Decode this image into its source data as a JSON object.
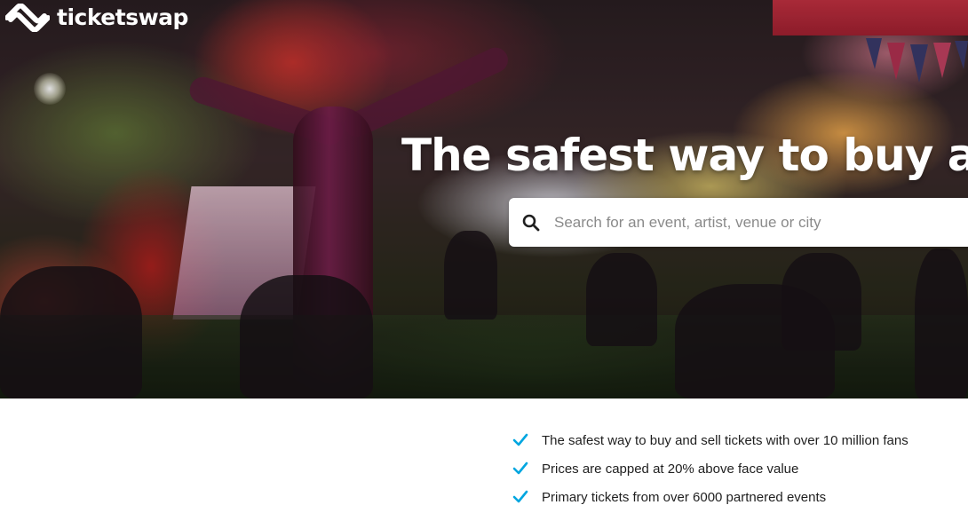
{
  "brand": {
    "name": "ticketswap",
    "logo_icon": "ticketswap-logo-icon"
  },
  "hero": {
    "headline": "The safest way to buy and",
    "search": {
      "placeholder": "Search for an event, artist, venue or city",
      "value": "",
      "icon": "search-icon"
    }
  },
  "features": [
    {
      "text": "The safest way to buy and sell tickets with over 10 million fans",
      "icon": "check-icon"
    },
    {
      "text": "Prices are capped at 20% above face value",
      "icon": "check-icon"
    },
    {
      "text": "Primary tickets from over 6000 partnered events",
      "icon": "check-icon"
    }
  ],
  "colors": {
    "accent": "#00a6e0",
    "headline": "#ffffff",
    "body_text": "#1f1f1f"
  }
}
